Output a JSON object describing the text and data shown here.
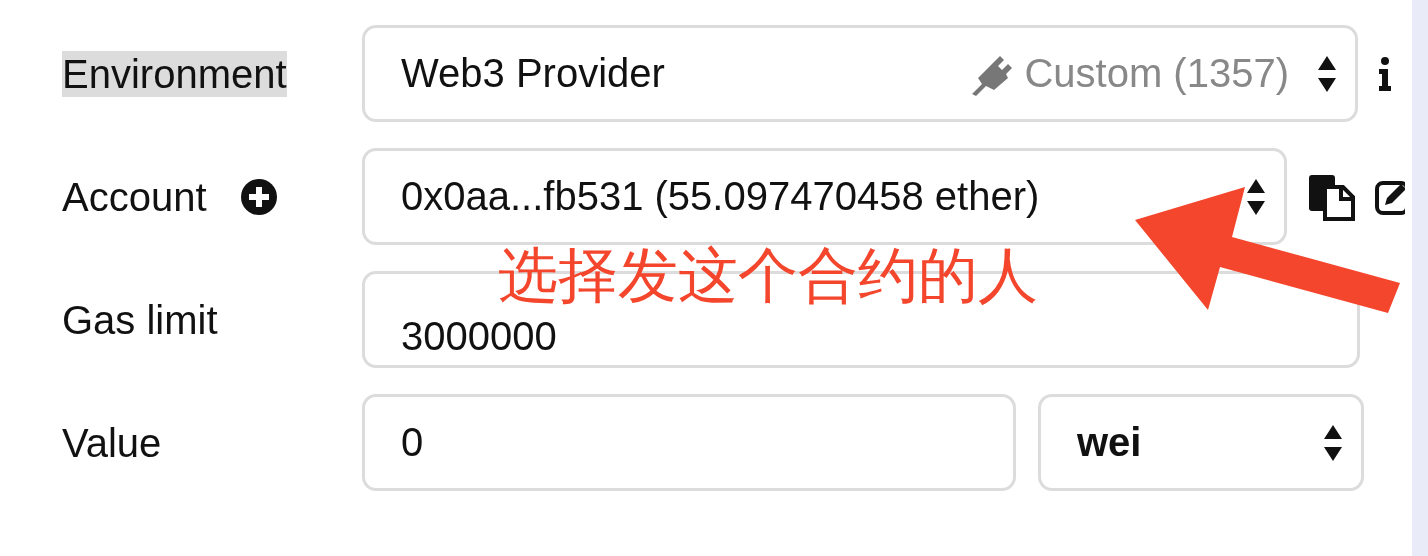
{
  "environment": {
    "label": "Environment",
    "highlighted": true,
    "value": "Web3 Provider",
    "network": "Custom (1357)"
  },
  "account": {
    "label": "Account",
    "value": "0x0aa...fb531 (55.097470458 ether)"
  },
  "gas_limit": {
    "label": "Gas limit",
    "value": "3000000"
  },
  "value": {
    "label": "Value",
    "value": "0",
    "unit": "wei"
  },
  "annotation": {
    "text": "选择发这个合约的人"
  }
}
